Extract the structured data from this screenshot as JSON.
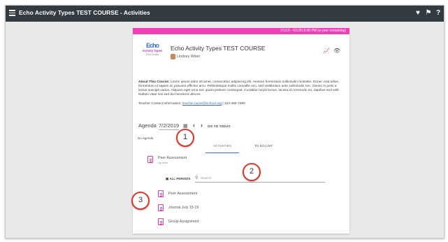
{
  "topbar": {
    "title": "Echo Activity Types TEST COURSE - Activities",
    "icons": [
      "heart-icon",
      "flag-icon",
      "help-icon"
    ]
  },
  "course": {
    "date_range": "7/1/19 - 6/1/20 8:00 PM (a year remaining)",
    "logo_rings": "Echo",
    "logo_line1": "Activity Types",
    "logo_line2": "Echo course",
    "title": "Echo Activity Types TEST COURSE",
    "teacher": "Lindsey Wiser",
    "about_label": "About This Course:",
    "about_text": "Lorem ipsum dolor sit amet, consectetur adipiscing elit. Aenean fermentum sollicitudin molestie. Donec erat tellus, fermentum id sapien id, posuere efficitur arcu. Pellentesque mollis convallis orci, sed vestibulum ante sollicitudin nec. Donec in justo a lectus suscipit varius. Aliquam eget urna nec quam pretium consequat. Curabitur turpis lectus, lacinia id commodo eu, dapibus sed velit. Nullam vitae nisi sed dui hendrerit ultrices.",
    "contact_label": "Teacher Contact Information:",
    "contact_email": "teacher.name@school.org",
    "contact_sep": "|",
    "contact_phone": "123-456-7890"
  },
  "agenda": {
    "label": "Agenda",
    "date": "7/2/2019",
    "goto_today": "GO TO TODAY",
    "no_agenda": "No agenda"
  },
  "tabs": [
    {
      "label": "ACTIVITIES",
      "active": true
    },
    {
      "label": "TO DO LIST",
      "active": false
    }
  ],
  "top_item": {
    "title": "Peer Assessment",
    "subtitle": "Up next"
  },
  "filter": {
    "all_periods": "ALL PERIODS",
    "search_placeholder": "Search"
  },
  "activities": [
    {
      "title": "Peer Assessment"
    },
    {
      "title": "Journal July 15-19"
    },
    {
      "title": "Group Assignment"
    }
  ],
  "callouts": [
    "1",
    "2",
    "3"
  ],
  "colors": {
    "accent_pink": "#ef3fb6",
    "topbar": "#333a40",
    "link": "#2e72c9",
    "callout_ring": "#d9382e"
  }
}
